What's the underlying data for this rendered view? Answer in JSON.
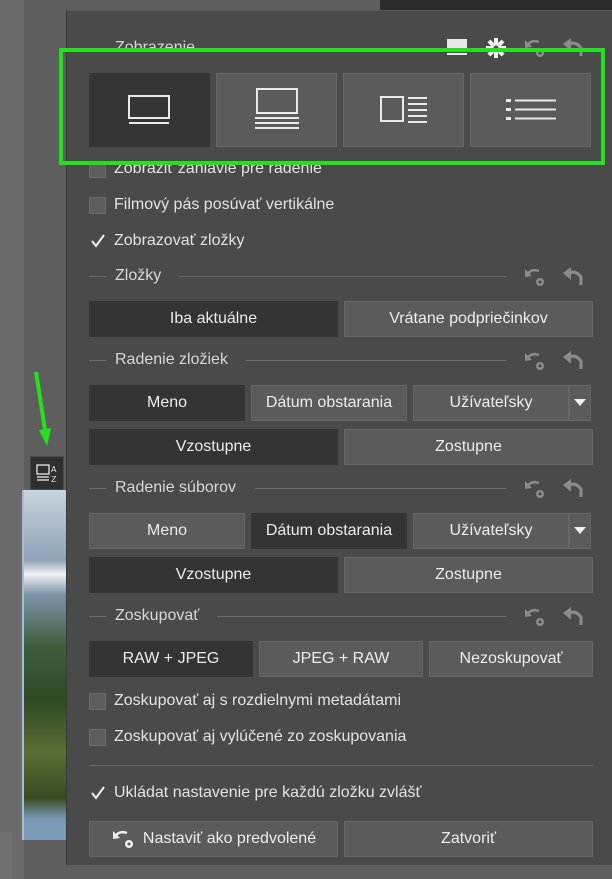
{
  "colors": {
    "highlight": "#21e21c",
    "panel_bg": "#4a4a4a",
    "active_btn": "#343434",
    "button": "#5b5b5b"
  },
  "display": {
    "title": "Zobrazenie",
    "header_icons": [
      "single-view-icon",
      "settings-icon",
      "reset-default-icon",
      "undo-icon"
    ],
    "view_modes": [
      "single-view-icon",
      "filmstrip-view-icon",
      "preview-list-view-icon",
      "list-view-icon"
    ],
    "active_view": 0
  },
  "options": {
    "show_sort_header": "Zobraziť záhlavie pre radenie",
    "vertical_filmstrip": "Filmový pás posúvať vertikálne",
    "show_folders": "Zobrazovať zložky"
  },
  "folders": {
    "title": "Zložky",
    "current_only": "Iba aktuálne",
    "include_subfolders": "Vrátane podpriečinkov"
  },
  "folder_sort": {
    "title": "Radenie zložiek",
    "name": "Meno",
    "date_taken": "Dátum obstarania",
    "custom": "Užívateľsky",
    "ascending": "Vzostupne",
    "descending": "Zostupne"
  },
  "file_sort": {
    "title": "Radenie súborov",
    "name": "Meno",
    "date_taken": "Dátum obstarania",
    "custom": "Užívateľsky",
    "ascending": "Vzostupne",
    "descending": "Zostupne"
  },
  "grouping": {
    "title": "Zoskupovať",
    "raw_jpeg": "RAW + JPEG",
    "jpeg_raw": "JPEG + RAW",
    "no_group": "Nezoskupovať",
    "different_metadata": "Zoskupovať aj s rozdielnymi metadátami",
    "excluded": "Zoskupovať aj vylúčené zo zoskupovania"
  },
  "footer": {
    "save_per_folder": "Ukládat nastavenie pre každú zložku zvlášť",
    "set_default": "Nastaviť ako predvolené",
    "close": "Zatvoriť"
  },
  "sidebar": {
    "sort_icon_label": "A Z"
  }
}
